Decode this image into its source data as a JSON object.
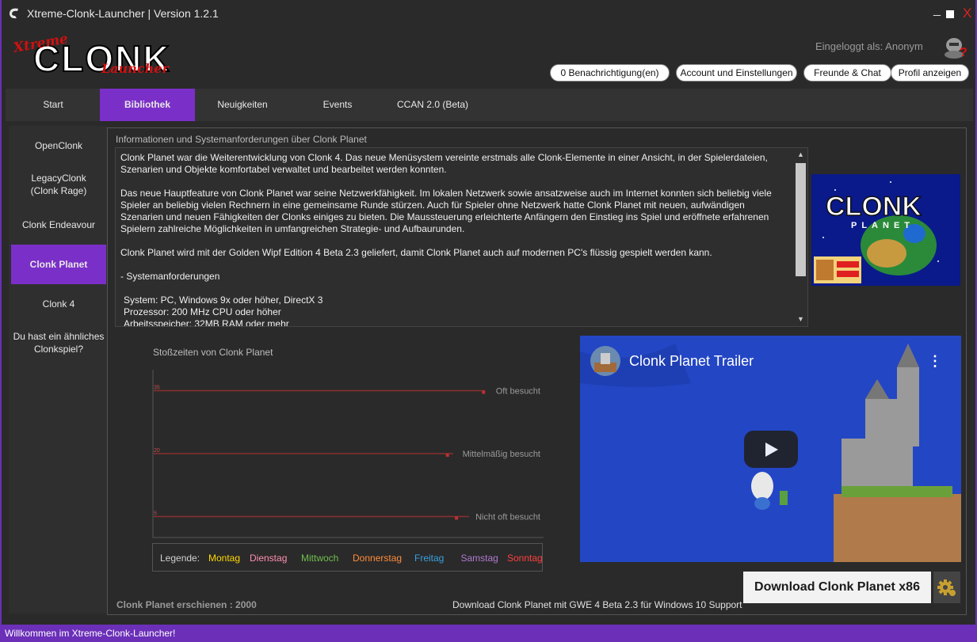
{
  "window": {
    "title": "Xtreme-Clonk-Launcher | Version 1.2.1",
    "minimize": "_",
    "close": "X"
  },
  "header": {
    "logo_text_top": "Xtreme",
    "logo_text_main": "CLONK",
    "logo_text_sub": "Launcher",
    "login_text": "Eingeloggt als: Anonym",
    "buttons": {
      "notifications": "0 Benachrichtigung(en)",
      "account": "Account und Einstellungen",
      "friends": "Freunde & Chat",
      "profile": "Profil anzeigen"
    }
  },
  "nav": {
    "tabs": [
      "Start",
      "Bibliothek",
      "Neuigkeiten",
      "Events",
      "CCAN 2.0 (Beta)"
    ],
    "active": "Bibliothek"
  },
  "sidebar": {
    "items": [
      {
        "label": "OpenClonk"
      },
      {
        "label": "LegacyClonk\n(Clonk Rage)"
      },
      {
        "label": "Clonk Endeavour"
      },
      {
        "label": "Clonk Planet"
      },
      {
        "label": "Clonk 4"
      },
      {
        "label": "Du hast ein ähnliches\nClonkspiel?"
      }
    ],
    "active": "Clonk Planet"
  },
  "info": {
    "label": "Informationen und Systemanforderungen über Clonk Planet",
    "paragraphs": [
      "Clonk Planet war die Weiterentwicklung von Clonk 4. Das neue Menüsystem vereinte erstmals alle Clonk-Elemente in einer Ansicht, in der Spielerdateien, Szenarien und Objekte komfortabel verwaltet und bearbeitet werden konnten.",
      "Das neue Hauptfeature von Clonk Planet war seine Netzwerkfähigkeit. Im lokalen Netzwerk sowie ansatzweise auch im Internet konnten sich beliebig viele Spieler an beliebig vielen Rechnern in eine gemeinsame Runde stürzen. Auch für Spieler ohne Netzwerk hatte Clonk Planet mit neuen, aufwändigen Szenarien und neuen Fähigkeiten der Clonks einiges zu bieten. Die Maussteuerung erleichterte Anfängern den Einstieg ins Spiel und eröffnete erfahrenen Spielern zahlreiche Möglichkeiten in umfangreichen Strategie- und Aufbaurunden.",
      "Clonk Planet wird mit der Golden Wipf Edition 4 Beta 2.3 geliefert, damit Clonk Planet auch auf modernen PC's flüssig gespielt werden kann.",
      "- Systemanforderungen"
    ],
    "requirements": [
      "System: PC, Windows 9x oder höher, DirectX 3",
      "Prozessor: 200 MHz CPU oder höher",
      "Arbeitsspeicher: 32MB RAM oder mehr"
    ],
    "image_text_main": "CLONK",
    "image_text_sub": "PLANET"
  },
  "chart_data": {
    "type": "line",
    "title": "Stoßzeiten von Clonk Planet",
    "yticks": [
      35,
      20,
      5
    ],
    "reference_lines": [
      {
        "value": 35,
        "label": "Oft besucht"
      },
      {
        "value": 20,
        "label": "Mittelmäßig besucht"
      },
      {
        "value": 5,
        "label": "Nicht oft besucht"
      }
    ],
    "ylim": [
      0,
      40
    ],
    "legend_title": "Legende:",
    "series": [
      {
        "name": "Montag",
        "color": "#ffd700",
        "values": []
      },
      {
        "name": "Dienstag",
        "color": "#ff8fb1",
        "values": []
      },
      {
        "name": "Mittwoch",
        "color": "#6fbf4f",
        "values": []
      },
      {
        "name": "Donnerstag",
        "color": "#ff8c3a",
        "values": []
      },
      {
        "name": "Freitag",
        "color": "#3aa0e0",
        "values": []
      },
      {
        "name": "Samstag",
        "color": "#b07ad0",
        "values": []
      },
      {
        "name": "Sonntag",
        "color": "#ff4040",
        "values": []
      }
    ]
  },
  "video": {
    "title": "Clonk Planet Trailer",
    "menu": "⋮"
  },
  "download": {
    "button_label": "Download Clonk Planet x86",
    "settings_icon": "gear-icon",
    "info": "Download Clonk Planet mit GWE 4 Beta 2.3 für Windows 10 Support",
    "release": "Clonk Planet erschienen : 2000"
  },
  "status": {
    "text": "Willkommen im Xtreme-Clonk-Launcher!"
  }
}
